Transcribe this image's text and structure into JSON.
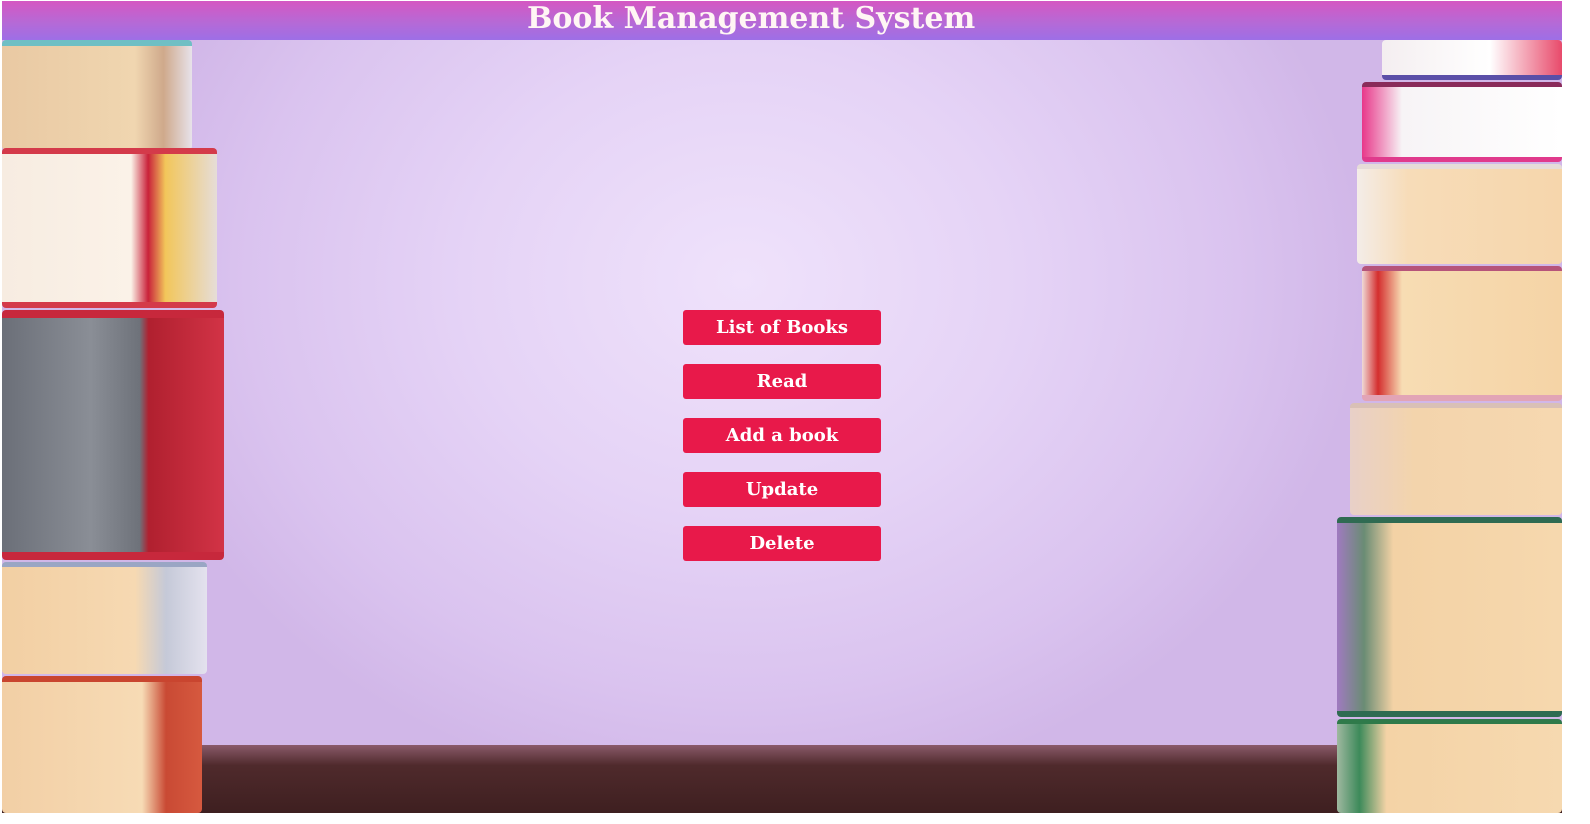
{
  "header": {
    "title": "Book Management System"
  },
  "menu": {
    "items": [
      {
        "label": "List of Books"
      },
      {
        "label": "Read"
      },
      {
        "label": "Add a book"
      },
      {
        "label": "Update"
      },
      {
        "label": "Delete"
      }
    ]
  },
  "colors": {
    "header_top": "#d557c2",
    "header_bottom": "#9d6fe6",
    "button": "#e8194a",
    "button_text": "#ffffff",
    "background": "#e5d3f6"
  }
}
